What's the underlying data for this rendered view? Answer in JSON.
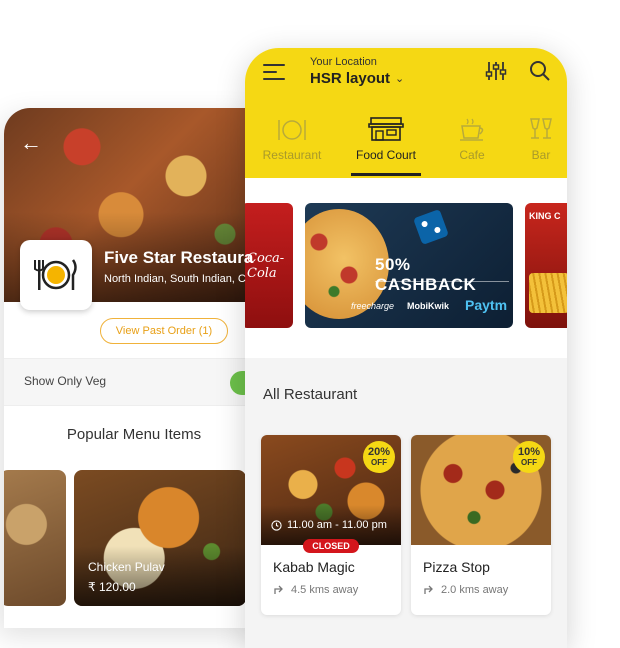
{
  "back_screen": {
    "restaurant_name": "Five Star Restaura",
    "cuisine": "North Indian, South Indian, C",
    "past_order_button": "View Past Order (1)",
    "veg_toggle_label": "Show Only Veg",
    "veg_toggle_on": true,
    "section_title": "Popular Menu Items",
    "menu_items": [
      {
        "name": "Chicken Pulav",
        "price": "₹ 120.00"
      }
    ]
  },
  "front_screen": {
    "location_label": "Your Location",
    "location": "HSR layout",
    "tabs": [
      {
        "label": "Restaurant",
        "icon": "plate-icon",
        "active": false
      },
      {
        "label": "Food Court",
        "icon": "shop-icon",
        "active": true
      },
      {
        "label": "Cafe",
        "icon": "coffee-cup-icon",
        "active": false
      },
      {
        "label": "Bar",
        "icon": "wine-glasses-icon",
        "active": false
      }
    ],
    "banners": {
      "left_brand": "Coca-Cola",
      "main_logo_text": "Domino's Pizza",
      "main_offer": "50% CASHBACK",
      "partners": [
        "freecharge",
        "MobiKwik",
        "Paytm"
      ],
      "right_brand": "KING C"
    },
    "section_title": "All Restaurant",
    "restaurants": [
      {
        "name": "Kabab Magic",
        "offer_percent": "20%",
        "offer_label": "OFF",
        "hours": "11.00 am - 11.00 pm",
        "status": "CLOSED",
        "distance": "4.5 kms away"
      },
      {
        "name": "Pizza Stop",
        "offer_percent": "10%",
        "offer_label": "OFF",
        "distance": "2.0 kms away"
      }
    ]
  },
  "colors": {
    "brand_yellow": "#f5d814",
    "closed_red": "#d4161c",
    "past_order_orange": "#f0b23a",
    "veg_green": "#6cc04a"
  }
}
